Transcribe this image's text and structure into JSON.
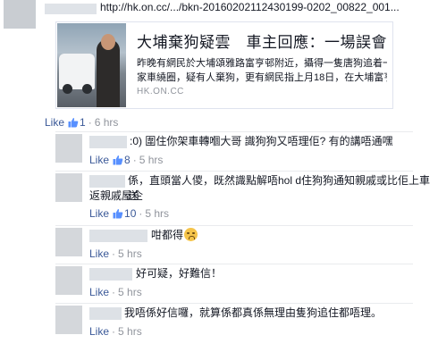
{
  "post": {
    "link_text": "http://hk.on.cc/.../bkn-20160202112430199-0202_00822_001...",
    "card": {
      "title": "大埔棄狗疑雲　車主回應：一場誤會",
      "description_line1": "昨晚有網民於大埔頌雅路富亨邨附近，攝得一隻唐狗追着一輛私",
      "description_line2": "家車繞圈，疑有人棄狗，更有網民指上月18日，在大埔富亨邨...",
      "domain": "HK.ON.CC"
    },
    "like_label": "Like",
    "separator": "·",
    "likes": "1",
    "time": "6 hrs"
  },
  "comments": [
    {
      "text": ":0) 圍住你架車轉嗰大哥 識狗狗又唔理佢? 有的講唔通嘿",
      "like_label": "Like",
      "separator": "·",
      "likes": "8",
      "time": "5 hrs"
    },
    {
      "text_line1": "係，直頭當人儍，既然識點解唔hol d住狗狗通知親戚或比佢上車送",
      "text_line2": "返親戚屋企",
      "like_label": "Like",
      "separator": "·",
      "likes": "10",
      "time": "5 hrs"
    },
    {
      "text": "咁都得",
      "emoji": "smile-emoji",
      "like_label": "Like",
      "separator": "·",
      "time": "5 hrs"
    },
    {
      "text": "好可疑，好難信！",
      "like_label": "Like",
      "separator": "·",
      "time": "5 hrs"
    },
    {
      "text": "我唔係好信囉，就算係都真係無理由隻狗追住都唔理。",
      "like_label": "Like",
      "separator": "·",
      "time": "5 hrs"
    }
  ],
  "colors": {
    "link": "#3b5998",
    "meta": "#90949c",
    "text": "#141823"
  },
  "icons": {
    "like": "thumbs-up-icon"
  }
}
